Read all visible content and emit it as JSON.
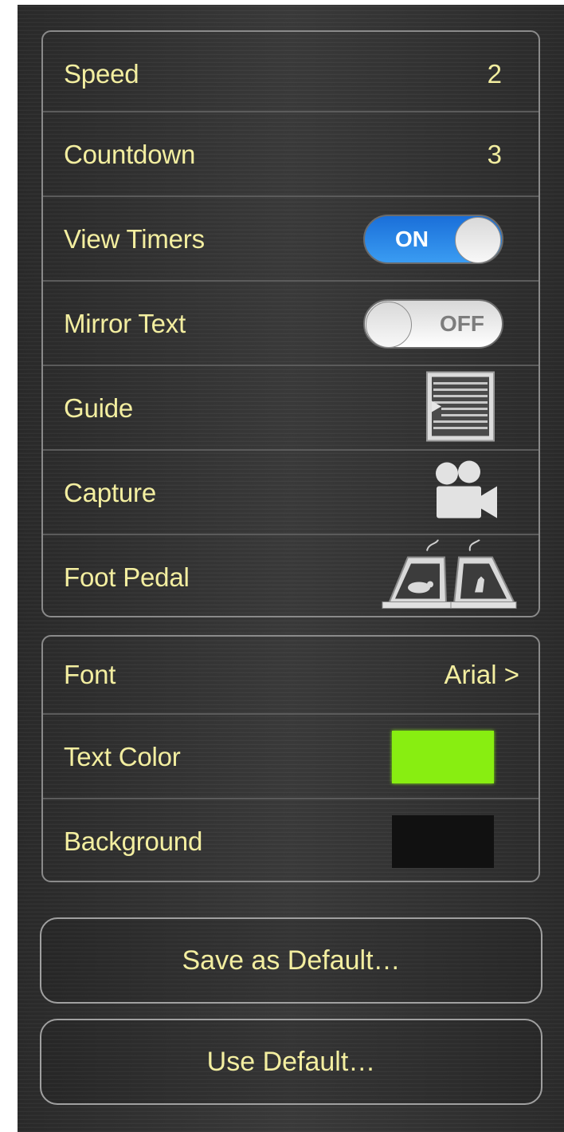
{
  "settings": {
    "speed": {
      "label": "Speed",
      "value": "2"
    },
    "countdown": {
      "label": "Countdown",
      "value": "3"
    },
    "view_timers": {
      "label": "View Timers",
      "state": "ON"
    },
    "mirror_text": {
      "label": "Mirror Text",
      "state": "OFF"
    },
    "guide": {
      "label": "Guide",
      "icon": "guide-icon"
    },
    "capture": {
      "label": "Capture",
      "icon": "video-camera-icon"
    },
    "foot_pedal": {
      "label": "Foot Pedal",
      "icon": "foot-pedal-icon"
    }
  },
  "appearance": {
    "font": {
      "label": "Font",
      "value": "Arial >"
    },
    "text_color": {
      "label": "Text Color",
      "color": "#88ee11"
    },
    "background": {
      "label": "Background",
      "color": "#111111"
    }
  },
  "buttons": {
    "save_default": "Save as Default…",
    "use_default": "Use Default…"
  },
  "colors": {
    "label_text": "#f3eea0",
    "panel_bg": "#2d2d2d",
    "switch_on": "#2f86ea"
  }
}
